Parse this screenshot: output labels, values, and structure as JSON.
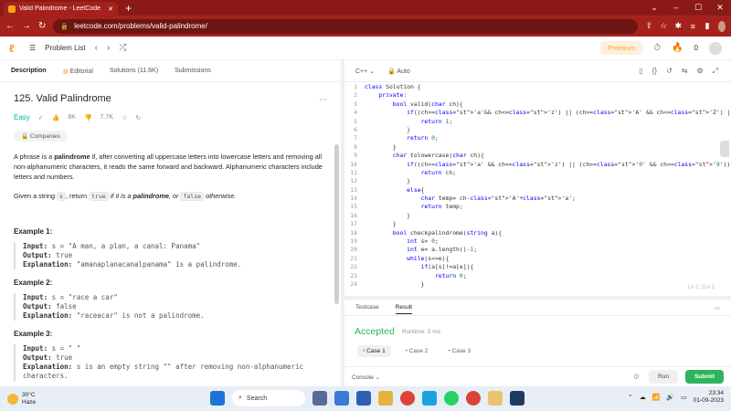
{
  "browser": {
    "tab_title": "Valid Palindrome - LeetCode",
    "url": "leetcode.com/problems/valid-palindrome/"
  },
  "lc_nav": {
    "problem_list": "Problem List",
    "premium": "Premium",
    "streak": "0"
  },
  "left_tabs": [
    "Description",
    "Editorial",
    "Solutions (11.6K)",
    "Submissions"
  ],
  "problem": {
    "title": "125. Valid Palindrome",
    "difficulty": "Easy",
    "likes": "8K",
    "dislikes": "7.7K",
    "companies": "Companies",
    "desc_a": "A phrase is a ",
    "desc_b": "palindrome",
    "desc_c": " if, after converting all uppercase letters into lowercase letters and removing all non-alphanumeric characters, it reads the same forward and backward. Alphanumeric characters include letters and numbers.",
    "given_a": "Given a string ",
    "given_s": "s",
    "given_b": ", return ",
    "given_true": "true",
    "given_c": " if it is a ",
    "given_pal": "palindrome",
    "given_d": ", or ",
    "given_false": "false",
    "given_e": " otherwise."
  },
  "examples": [
    {
      "title": "Example 1:",
      "input": "s = \"A man, a plan, a canal: Panama\"",
      "output": "true",
      "explanation": "\"amanaplanacanalpanama\" is a palindrome."
    },
    {
      "title": "Example 2:",
      "input": "s = \"race a car\"",
      "output": "false",
      "explanation": "\"raceacar\" is not a palindrome."
    },
    {
      "title": "Example 3:",
      "input": "s = \" \"",
      "output": "true",
      "explanation": "s is an empty string \"\" after removing non-alphanumeric characters."
    }
  ],
  "labels": {
    "input": "Input:",
    "output": "Output:",
    "explanation": "Explanation:"
  },
  "editor": {
    "language": "C++",
    "auto": "Auto",
    "cursor": "Ln 1, Col 1"
  },
  "code_lines": [
    "class Solution {",
    "    private:",
    "        bool valid(char ch){",
    "            if((ch>='a'&& ch<='z') || (ch>='A' && ch<='Z') || (ch>='0' && ch<='9')){",
    "                return 1;",
    "            }",
    "            return 0;",
    "        }",
    "        char tolowercase(char ch){",
    "            if((ch>='a' && ch<='z') || (ch>='0' && ch<='9')){",
    "                return ch;",
    "            }",
    "            else{",
    "                char temp= ch-'A'+'a';",
    "                return temp;",
    "            }",
    "        }",
    "        bool checkpalindrome(string a){",
    "            int s= 0;",
    "            int e= a.length()-1;",
    "            while(s<=e){",
    "                if(a[s]!=a[e]){",
    "                    return 0;",
    "                }"
  ],
  "console": {
    "tabs": [
      "Testcase",
      "Result"
    ],
    "status": "Accepted",
    "runtime": "Runtime: 5 ms",
    "cases": [
      "Case 1",
      "Case 2",
      "Case 3"
    ],
    "console_label": "Console",
    "run": "Run",
    "submit": "Submit"
  },
  "taskbar": {
    "temp": "30°C",
    "weather": "Haze",
    "search": "Search",
    "time": "23:34",
    "date": "01-09-2023",
    "lang": "ENG IN"
  }
}
